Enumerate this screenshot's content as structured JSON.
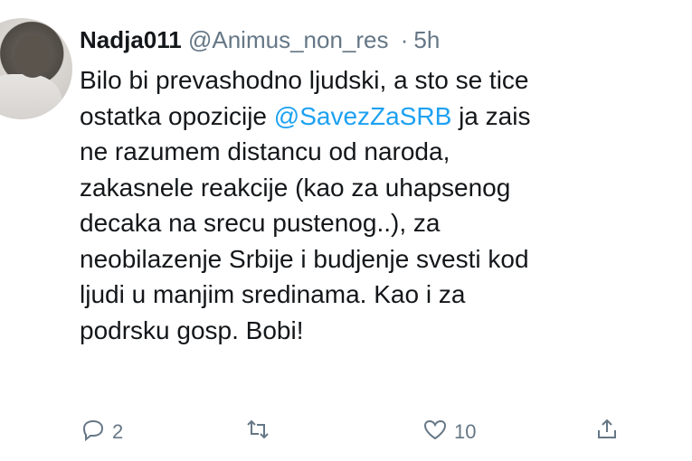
{
  "tweet": {
    "author_name": "Nadja011",
    "author_handle": "@Animus_non_res",
    "separator": "·",
    "timestamp": "5h",
    "lines": [
      "Bilo bi prevashodno ljudski, a sto se tice",
      "ostatka opozicije",
      "ne razumem distancu od naroda,",
      "zakasnele reakcije (kao za uhapsenog",
      "decaka na srecu pustenog..), za",
      "neobilazenje Srbije i budjenje svesti kod",
      "ljudi u manjim sredinama. Kao i za",
      "podrsku gosp. Bobi!"
    ],
    "mention": "@SavezZaSRB",
    "line2_tail": " ja zais"
  },
  "actions": {
    "reply": {
      "icon": "reply-icon",
      "count": "2"
    },
    "retweet": {
      "icon": "retweet-icon",
      "count": ""
    },
    "like": {
      "icon": "heart-icon",
      "count": "10"
    },
    "share": {
      "icon": "share-icon",
      "count": ""
    }
  },
  "colors": {
    "text": "#14171a",
    "secondary": "#657786",
    "mention": "#1da1f2"
  }
}
